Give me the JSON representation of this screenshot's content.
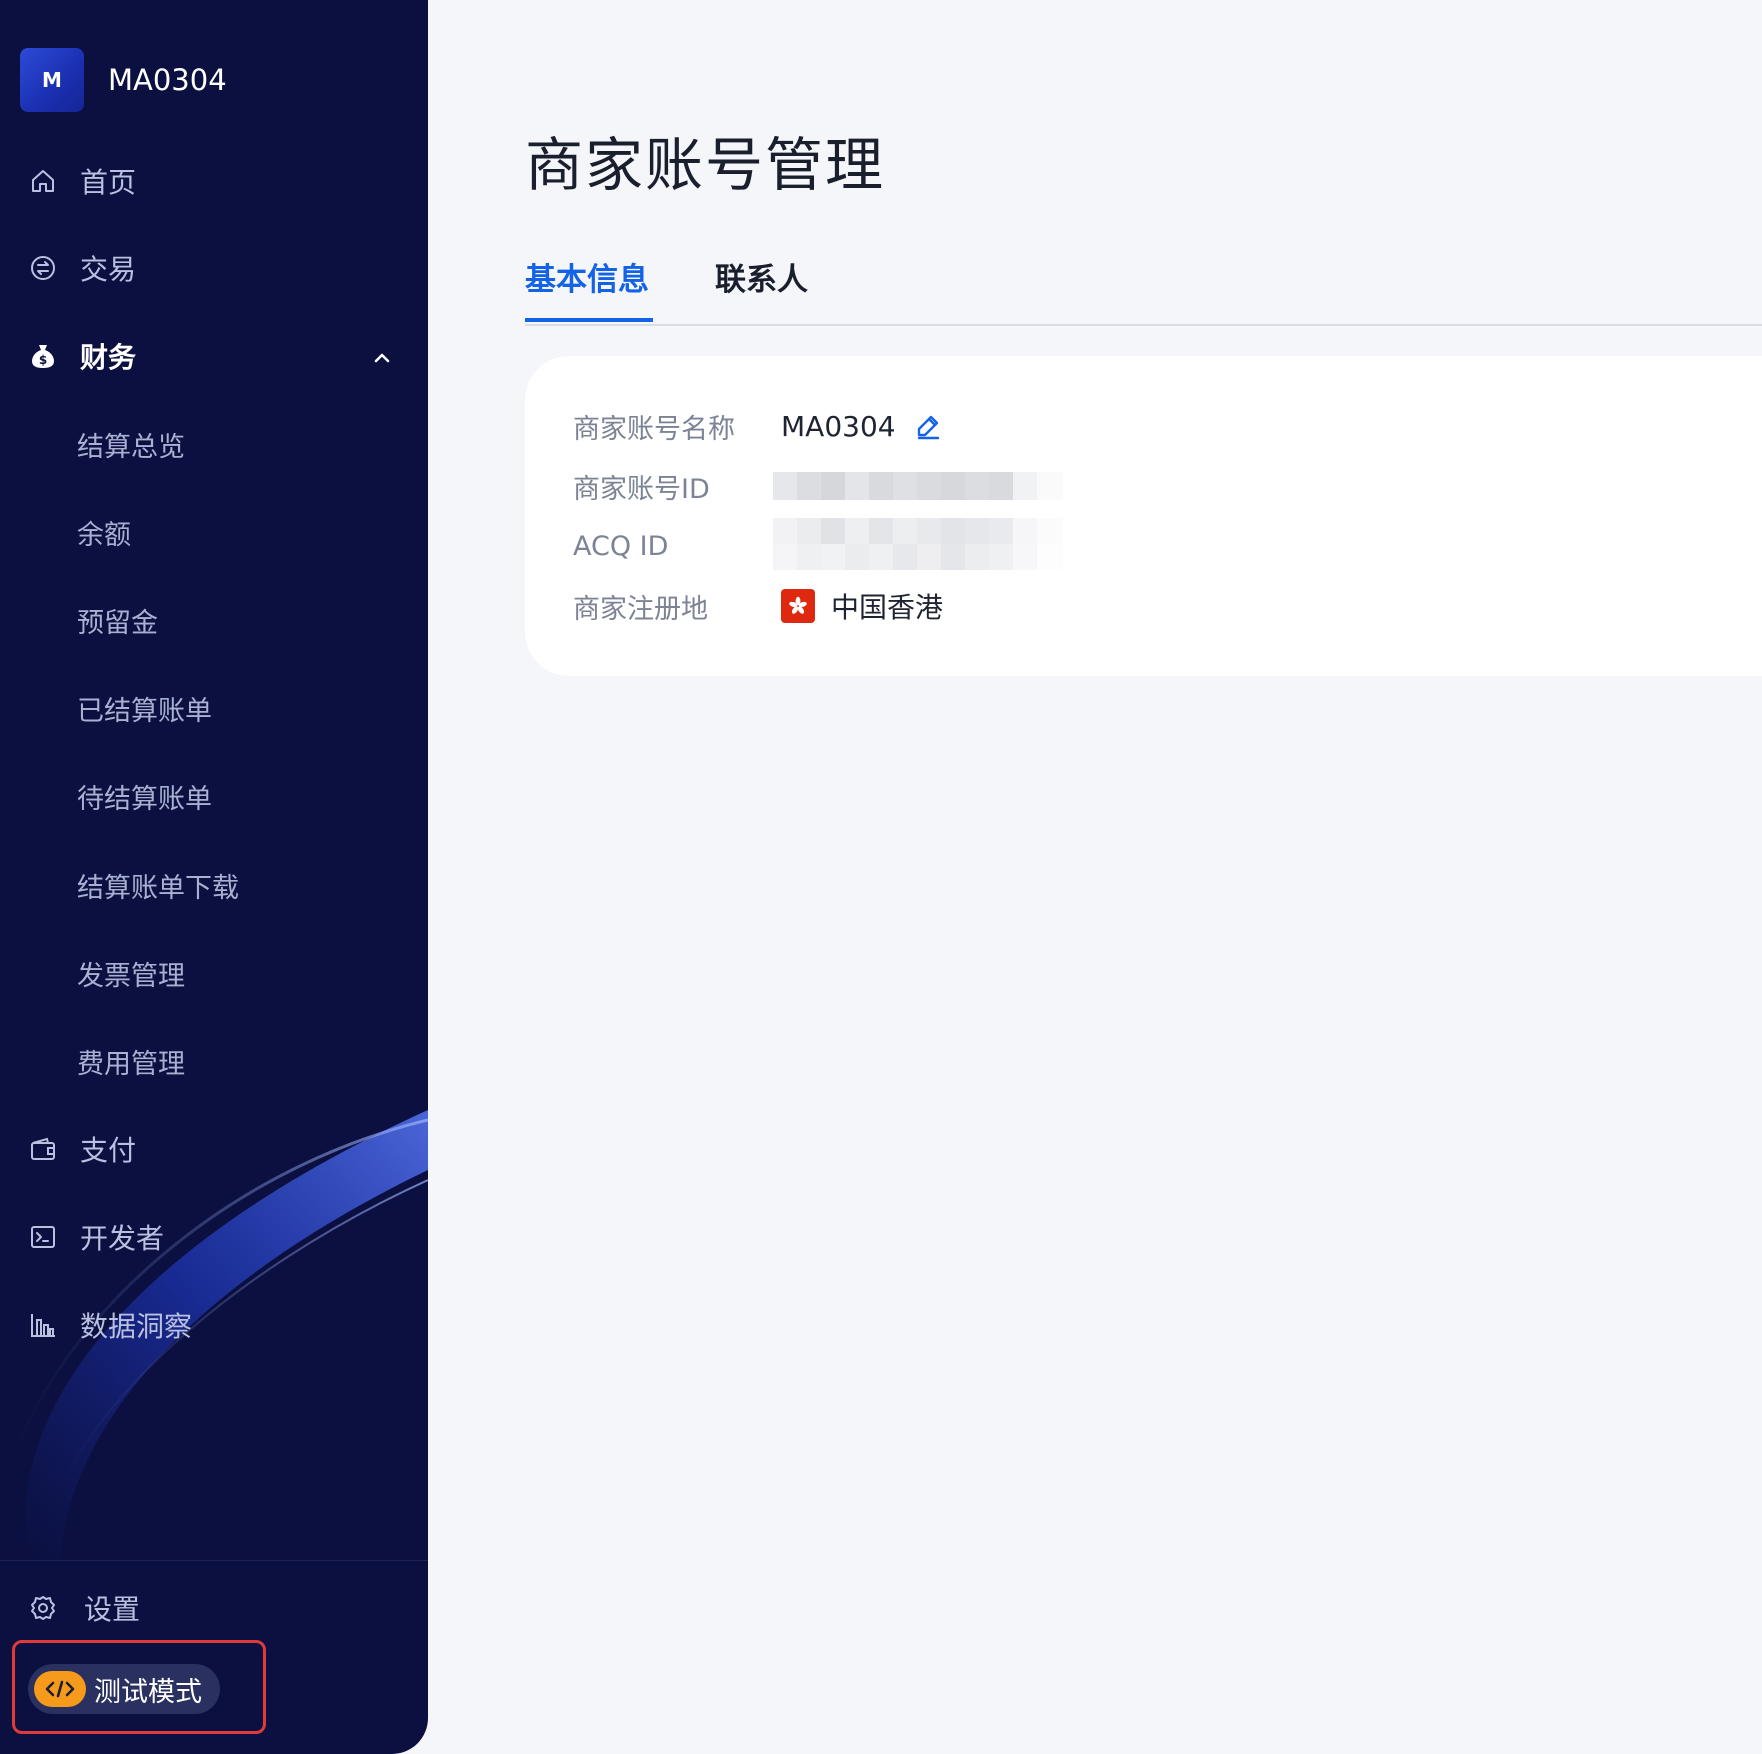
{
  "sidebar": {
    "brand": {
      "logo_letter": "M",
      "name": "MA0304"
    },
    "nav": [
      {
        "label": "首页",
        "icon": "home-icon"
      },
      {
        "label": "交易",
        "icon": "exchange-icon"
      },
      {
        "label": "财务",
        "icon": "money-bag-icon",
        "expanded": true
      }
    ],
    "finance_sub": [
      "结算总览",
      "余额",
      "预留金",
      "已结算账单",
      "待结算账单",
      "结算账单下载",
      "发票管理",
      "费用管理"
    ],
    "nav_more": [
      {
        "label": "支付",
        "icon": "wallet-icon"
      },
      {
        "label": "开发者",
        "icon": "terminal-icon"
      },
      {
        "label": "数据洞察",
        "icon": "bar-chart-icon"
      }
    ],
    "settings_label": "设置",
    "test_mode_label": "测试模式"
  },
  "main": {
    "title": "商家账号管理",
    "tabs": [
      "基本信息",
      "联系人"
    ],
    "active_tab": 0,
    "info": {
      "name_label": "商家账号名称",
      "name_value": "MA0304",
      "id_label": "商家账号ID",
      "acq_label": "ACQ ID",
      "region_label": "商家注册地",
      "region_value": "中国香港"
    }
  },
  "colors": {
    "sidebar_bg": "#0b1040",
    "accent": "#1463e6",
    "test_mode_badge": "#f59a1b",
    "test_mode_outline": "#e03a3a",
    "flag_red": "#de2910"
  }
}
